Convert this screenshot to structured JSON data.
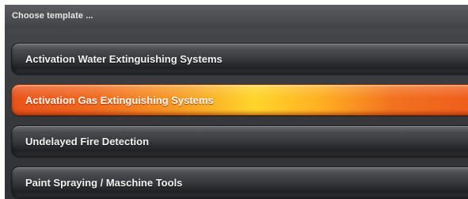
{
  "window": {
    "title": "Choose template ..."
  },
  "templates": {
    "items": [
      {
        "label": "Activation Water Extinguishing Systems",
        "selected": false
      },
      {
        "label": "Activation Gas Extinguishing Systems",
        "selected": true
      },
      {
        "label": "Undelayed Fire Detection",
        "selected": false
      },
      {
        "label": "Paint Spraying / Maschine Tools",
        "selected": false
      }
    ]
  },
  "colors": {
    "background": "#3b3d41",
    "button_dark": "#2f3135",
    "selected_orange": "#f06a1e",
    "selected_yellow": "#ffd52a",
    "text": "#f2f2f2"
  }
}
